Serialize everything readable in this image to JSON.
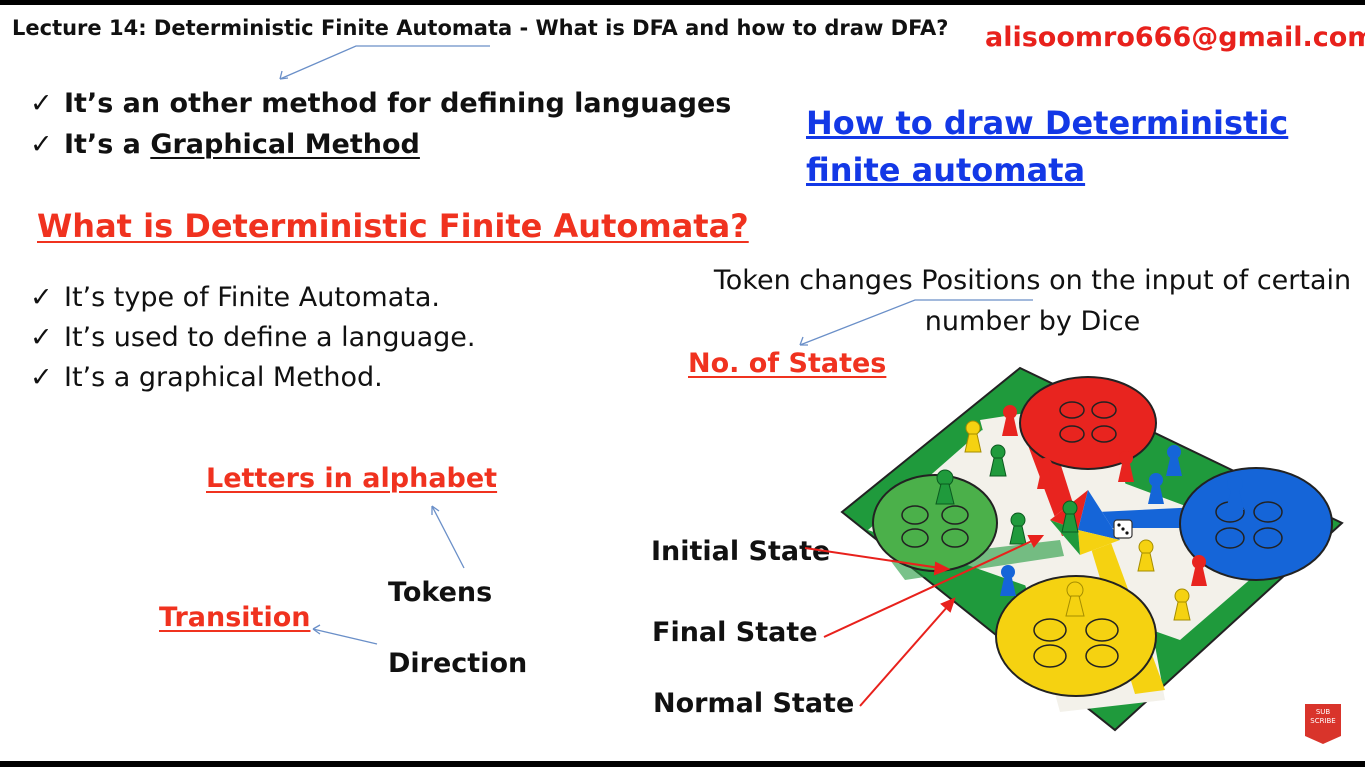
{
  "header": {
    "title": "Lecture 14: Deterministic Finite Automata - What is DFA and how to draw DFA?",
    "email": "alisoomro666@gmail.com"
  },
  "intro": {
    "check": "✓",
    "line1": "It’s an other method for defining languages",
    "line2_prefix": "It’s a ",
    "line2_underlined": "Graphical Method"
  },
  "heading_what": "What is Deterministic  Finite Automata?",
  "heading_how_line1": "How to draw Deterministic",
  "heading_how_line2": "finite automata",
  "points": [
    "It’s type of Finite Automata.",
    "It’s used to define a language.",
    "It’s a graphical Method."
  ],
  "token_description": "Token changes Positions on the input of certain number by Dice",
  "no_of_states": "No. of States",
  "letters_in_alphabet": "Letters in alphabet",
  "tokens": "Tokens",
  "transition": "Transition",
  "direction": "Direction",
  "state_labels": {
    "initial": "Initial State",
    "final": "Final State",
    "normal": "Normal State"
  },
  "subscribe": {
    "line1": "SUB",
    "line2": "SCRIBE"
  },
  "colors": {
    "red": "#f0321f",
    "blue": "#1338e6",
    "board_green": "#1f9a3c",
    "board_red": "#e8241f",
    "board_blue": "#1565d8",
    "board_yellow": "#f5d211"
  }
}
